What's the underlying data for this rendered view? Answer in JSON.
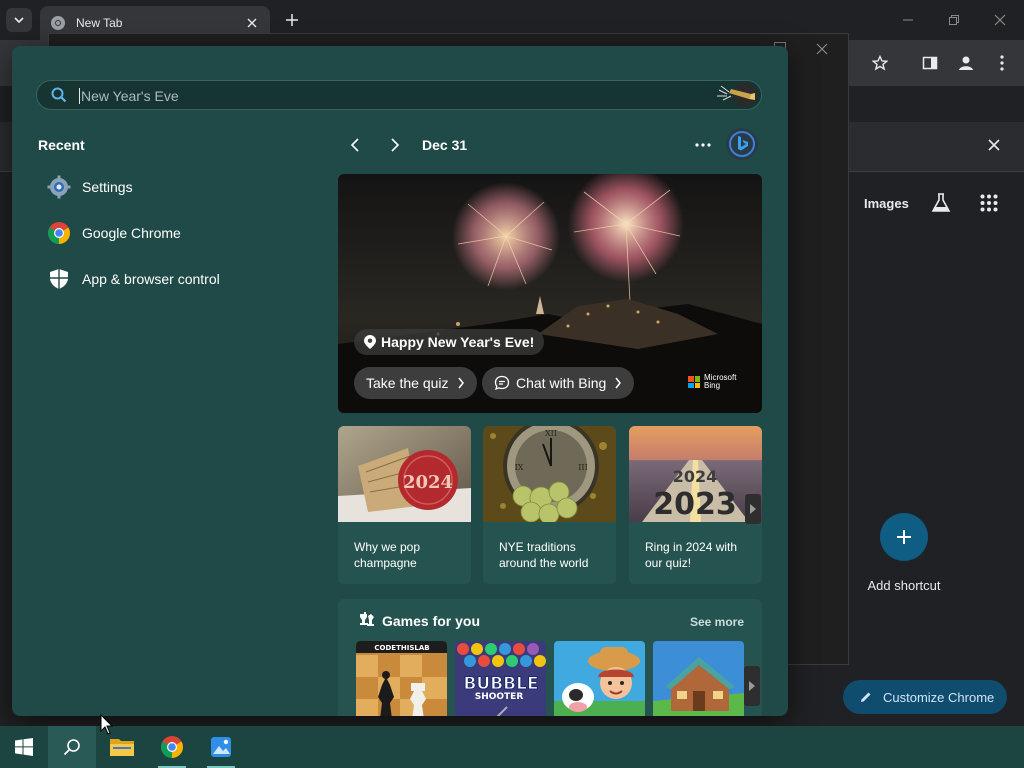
{
  "browser": {
    "tab_title": "New Tab",
    "images_link": "Images",
    "add_shortcut_label": "Add shortcut",
    "customize_label": "Customize Chrome"
  },
  "search": {
    "query_placeholder": "New Year's Eve"
  },
  "recent": {
    "title": "Recent",
    "items": [
      {
        "label": "Settings",
        "icon": "settings-gear-icon"
      },
      {
        "label": "Google Chrome",
        "icon": "chrome-icon"
      },
      {
        "label": "App & browser control",
        "icon": "shield-icon"
      }
    ]
  },
  "highlights": {
    "date": "Dec 31",
    "hero_title": "Happy New Year's Eve!",
    "quiz_button": "Take the quiz",
    "chat_button": "Chat with Bing",
    "brand_line1": "Microsoft",
    "brand_line2": "Bing",
    "cards": [
      {
        "caption": "Why we pop champagne",
        "thumb_text": "2024"
      },
      {
        "caption": "NYE traditions around the world"
      },
      {
        "caption": "Ring in 2024 with our quiz!",
        "thumb_text_top": "2024",
        "thumb_text_bottom": "2023"
      }
    ]
  },
  "games": {
    "title": "Games for you",
    "see_more": "See more",
    "tiles": [
      {
        "name": "chess",
        "label": "CODETHISLAB"
      },
      {
        "name": "bubble-shooter",
        "label": "BUBBLE",
        "label2": "SHOOTER"
      },
      {
        "name": "farm-game"
      },
      {
        "name": "house-game"
      }
    ]
  },
  "colors": {
    "flyout_bg": "#1f4a47",
    "taskbar_bg": "#1c4541",
    "accent": "#0f5d82"
  }
}
